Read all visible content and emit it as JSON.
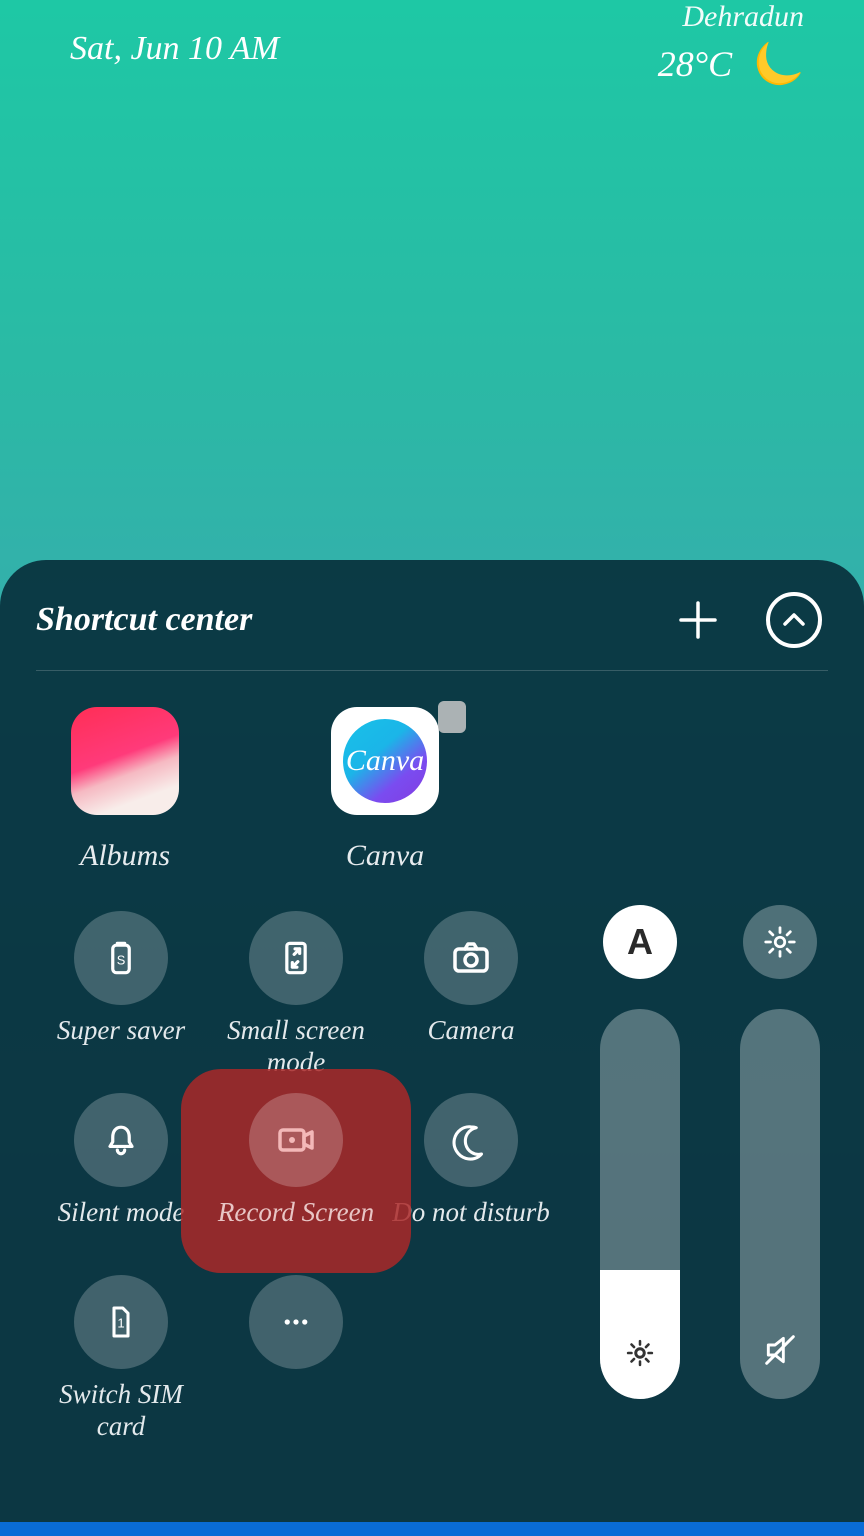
{
  "status": {
    "date": "Sat, Jun 10 AM",
    "city": "Dehradun",
    "temperature": "28°C",
    "weather_icon": "moon"
  },
  "panel": {
    "title": "Shortcut center"
  },
  "apps": [
    {
      "name": "albums",
      "label": "Albums"
    },
    {
      "name": "canva",
      "label": "Canva",
      "locked": true,
      "badge_text": "Canva"
    }
  ],
  "toggles": {
    "row1": [
      {
        "id": "super-saver",
        "label": "Super saver"
      },
      {
        "id": "small-screen",
        "label": "Small screen mode"
      },
      {
        "id": "camera",
        "label": "Camera"
      }
    ],
    "row2": [
      {
        "id": "silent-mode",
        "label": "Silent mode"
      },
      {
        "id": "record-screen",
        "label": "Record Screen",
        "highlighted": true
      },
      {
        "id": "dnd",
        "label": "Do not disturb"
      }
    ],
    "row3": [
      {
        "id": "switch-sim",
        "label": "Switch SIM card"
      },
      {
        "id": "more",
        "label": ""
      }
    ]
  },
  "sliders": {
    "brightness": {
      "auto_label": "A",
      "fill_percent": 33,
      "muted": false
    },
    "volume": {
      "fill_percent": 0,
      "muted": true
    }
  }
}
